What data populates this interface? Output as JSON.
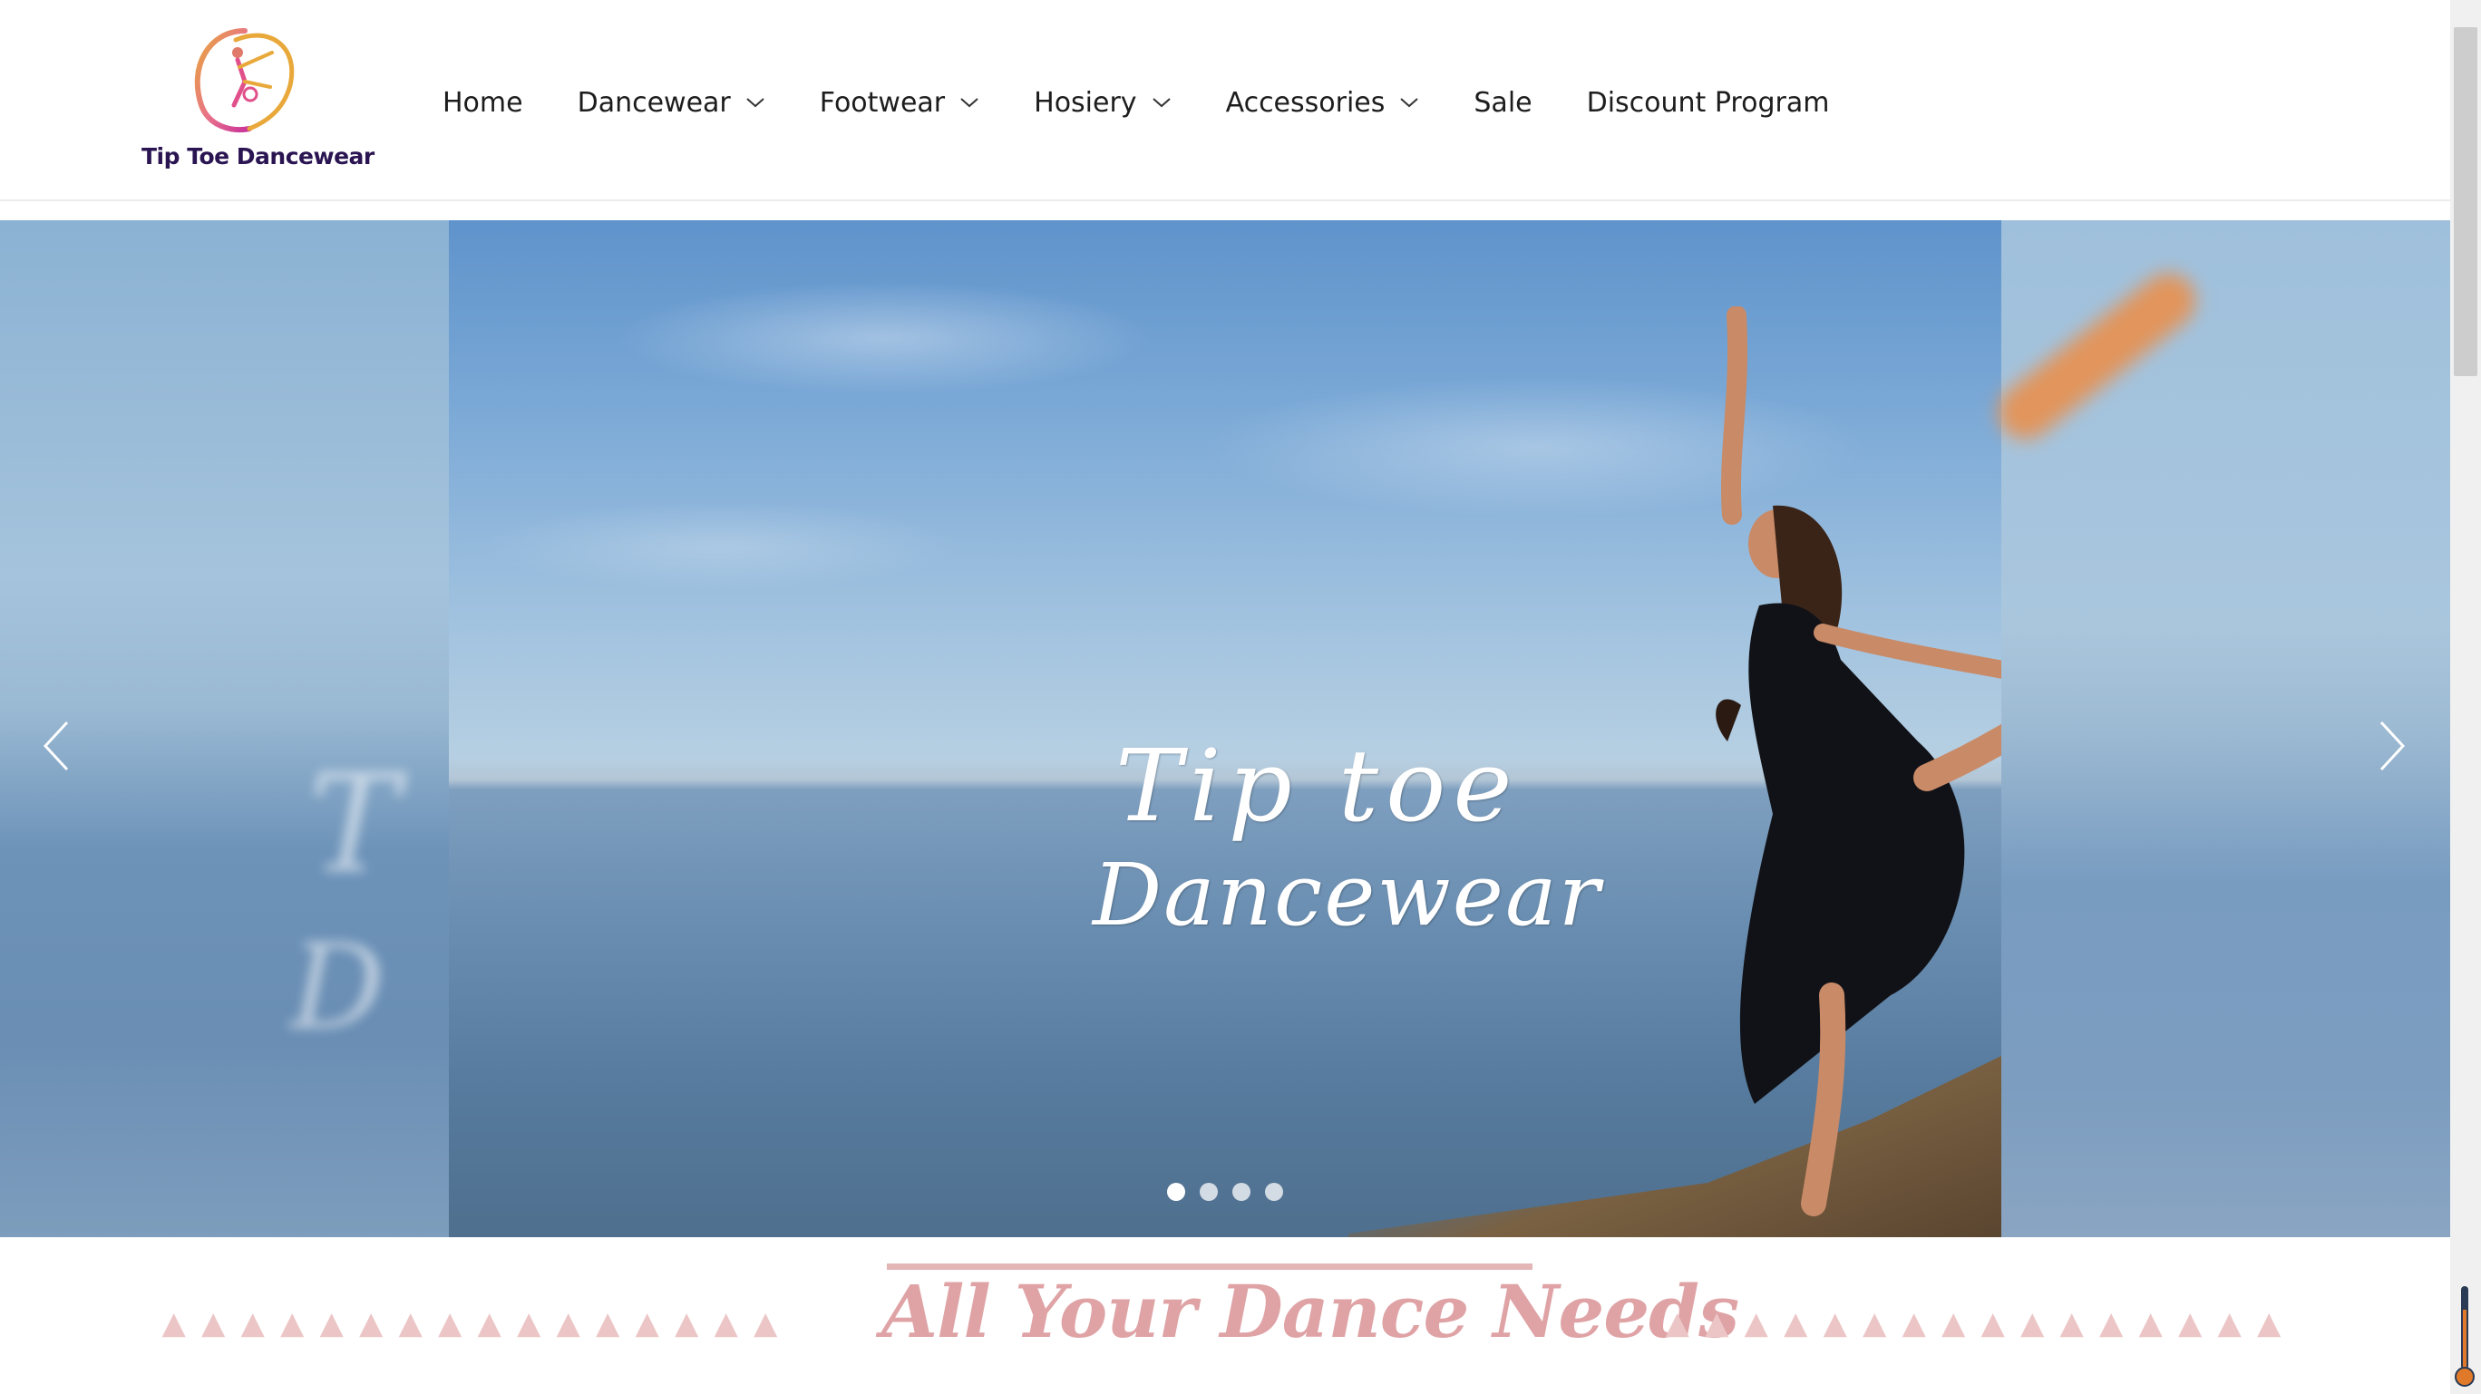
{
  "brand": {
    "name": "Tip Toe Dancewear"
  },
  "nav": {
    "items": [
      {
        "label": "Home",
        "dropdown": false
      },
      {
        "label": "Dancewear",
        "dropdown": true
      },
      {
        "label": "Footwear",
        "dropdown": true
      },
      {
        "label": "Hosiery",
        "dropdown": true
      },
      {
        "label": "Accessories",
        "dropdown": true
      },
      {
        "label": "Sale",
        "dropdown": false
      },
      {
        "label": "Discount Program",
        "dropdown": false
      }
    ]
  },
  "hero": {
    "line1": "Tip toe",
    "line2": "Dancewear",
    "slide_count": 4,
    "active_slide": 1,
    "prev_icon": "chevron-left-icon",
    "next_icon": "chevron-right-icon"
  },
  "section": {
    "tagline": "All Your Dance Needs"
  },
  "colors": {
    "accent_pink": "#dfa3a6",
    "logo_gold": "#e8a83a",
    "logo_pink": "#e0508a",
    "logo_text": "#2a1552"
  }
}
